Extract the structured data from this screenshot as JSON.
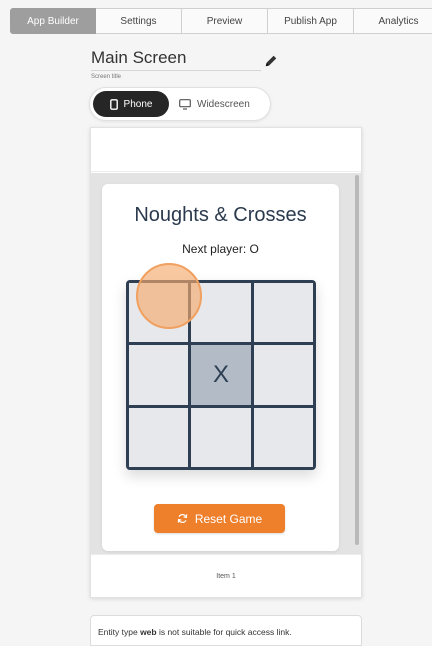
{
  "tabs": [
    {
      "label": "App Builder",
      "active": true
    },
    {
      "label": "Settings",
      "active": false
    },
    {
      "label": "Preview",
      "active": false
    },
    {
      "label": "Publish App",
      "active": false
    },
    {
      "label": "Analytics",
      "active": false
    }
  ],
  "screen": {
    "title": "Main Screen",
    "title_label": "Screen title"
  },
  "device_toggle": {
    "phone_label": "Phone",
    "widescreen_label": "Widescreen",
    "selected": "Phone"
  },
  "game": {
    "title": "Noughts & Crosses",
    "next_player": "Next player: O",
    "board": [
      "",
      "",
      "",
      "",
      "X",
      "",
      "",
      "",
      ""
    ],
    "reset_label": "Reset Game"
  },
  "phone_bottom": {
    "item_label": "Item 1"
  },
  "notice": {
    "prefix": "Entity type ",
    "entity": "web",
    "suffix": " is not suitable for quick access link."
  },
  "colors": {
    "accent": "#ee7f2b",
    "board": "#2e3f54",
    "active_tab": "#9e9e9e"
  }
}
